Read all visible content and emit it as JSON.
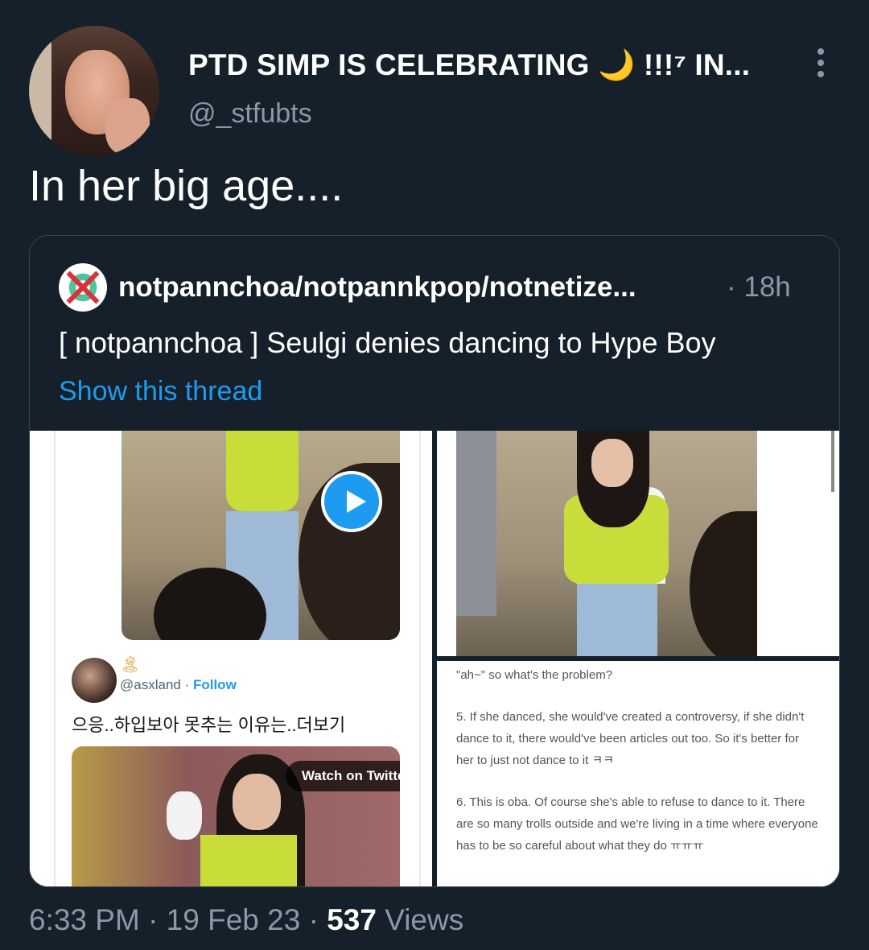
{
  "tweet": {
    "display_name": "PTD SIMP IS CELEBRATING 🌙 !!!⁷ IN...",
    "handle": "@_stfubts",
    "text": "In her big age....",
    "more_icon": "more-vertical-icon"
  },
  "quoted": {
    "name": "notpannchoa/notpannkpop/notnetize...",
    "time": "· 18h",
    "text": "[ notpannchoa ] Seulgi denies dancing to Hype Boy",
    "link": "Show this thread"
  },
  "media": {
    "left": {
      "mini_emoji": "🏝",
      "mini_handle": "@asxland · ",
      "mini_follow": "Follow",
      "mini_text": "으응..하입보아 못추는 이유는..더보기",
      "watch_label": "Watch on Twitter"
    },
    "right_bottom": {
      "line1": "\"ah~\" so what's the problem?",
      "line2": "5. If she danced, she would've created a controversy, if she didn't dance to it, there would've been articles out too. So it's better for her to just not dance to it ㅋㅋ",
      "line3": "6. This is oba. Of course she's able to refuse to dance to it. There are so many trolls outside and we're living in a time where everyone has to be so careful about what they do ㅠㅠㅠ"
    }
  },
  "footer": {
    "time": "6:33 PM · 19 Feb 23 · ",
    "views_count": "537",
    "views_label": " Views"
  }
}
